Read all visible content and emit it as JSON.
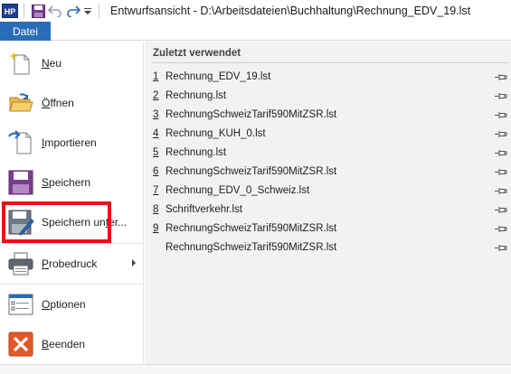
{
  "titlebar": {
    "app_icon_text": "HP",
    "title": "Entwurfsansicht - D:\\Arbeitsdateien\\Buchhaltung\\Rechnung_EDV_19.lst"
  },
  "tabs": {
    "file": "Datei"
  },
  "menu": {
    "items": [
      {
        "pre": "",
        "key": "N",
        "post": "eu"
      },
      {
        "pre": "",
        "key": "Ö",
        "post": "ffnen"
      },
      {
        "pre": "",
        "key": "I",
        "post": "mportieren"
      },
      {
        "pre": "",
        "key": "S",
        "post": "peichern"
      },
      {
        "pre": "Speichern un",
        "key": "t",
        "post": "er..."
      },
      {
        "pre": "",
        "key": "P",
        "post": "robedruck"
      },
      {
        "pre": "",
        "key": "O",
        "post": "ptionen"
      },
      {
        "pre": "",
        "key": "B",
        "post": "eenden"
      }
    ]
  },
  "recent": {
    "title": "Zuletzt verwendet",
    "files": [
      {
        "num": "1",
        "name": "Rechnung_EDV_19.lst"
      },
      {
        "num": "2",
        "name": "Rechnung.lst"
      },
      {
        "num": "3",
        "name": "RechnungSchweizTarif590MitZSR.lst"
      },
      {
        "num": "4",
        "name": "Rechnung_KUH_0.lst"
      },
      {
        "num": "5",
        "name": "Rechnung.lst"
      },
      {
        "num": "6",
        "name": "RechnungSchweizTarif590MitZSR.lst"
      },
      {
        "num": "7",
        "name": "Rechnung_EDV_0_Schweiz.lst"
      },
      {
        "num": "8",
        "name": "Schriftverkehr.lst"
      },
      {
        "num": "9",
        "name": "RechnungSchweizTarif590MitZSR.lst"
      },
      {
        "num": "",
        "name": "RechnungSchweizTarif590MitZSR.lst"
      }
    ]
  },
  "colors": {
    "tab_accent": "#2b6cb8",
    "highlight_border": "#e8101a",
    "recent_bg": "#f2f2f2"
  }
}
